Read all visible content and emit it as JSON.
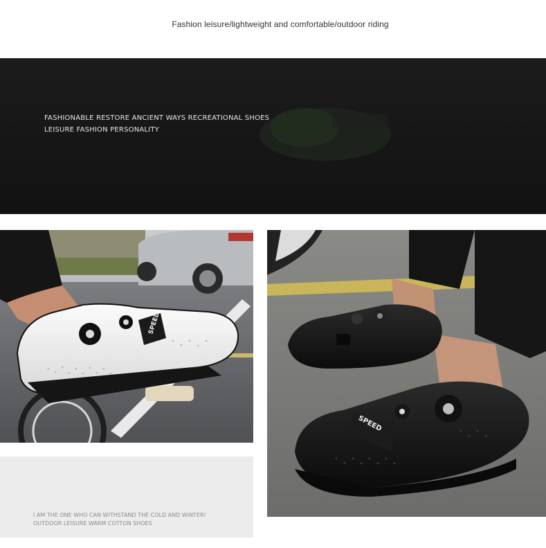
{
  "top_caption": "Fashion leisure/lightweight and comfortable/outdoor riding",
  "banner": {
    "line1": "FASHIONABLE RESTORE ANCIENT WAYS RECREATIONAL SHOES",
    "line2": "LEISURE FASHION PERSONALITY"
  },
  "grey_card": {
    "line1": "I AM THE ONE WHO CAN WITHSTAND THE COLD AND WINTER!",
    "line2": "OUTDOOR LEISURE WARM COTTON SHOES"
  },
  "photos": {
    "left_shoe_logo": "SPEED",
    "right_shoe_logo": "SPEED"
  },
  "colors": {
    "banner_bg": "#161616",
    "card_bg": "#ececec",
    "shoe_white": "#f2f2f2",
    "shoe_black": "#151515"
  }
}
